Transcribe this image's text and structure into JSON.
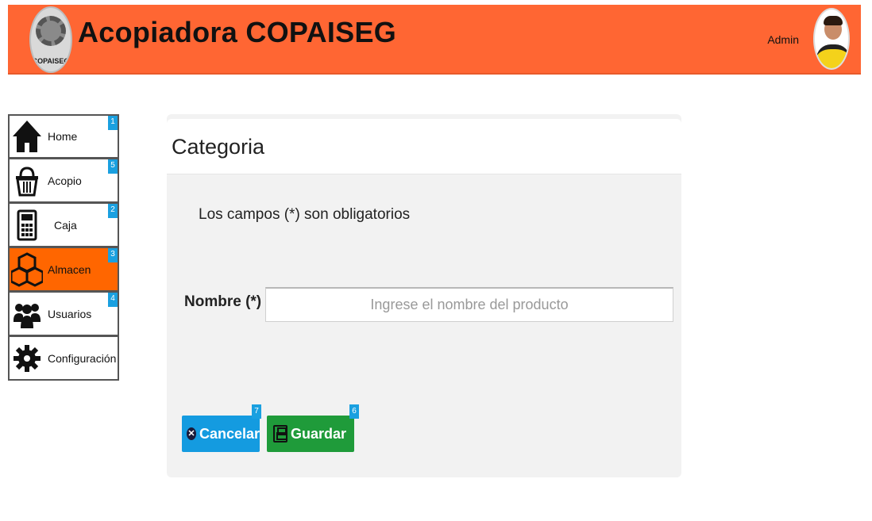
{
  "header": {
    "logo_text": "COPAISEG",
    "title": "Acopiadora COPAISEG",
    "user": "Admin",
    "colors": {
      "bar": "#ff6633"
    }
  },
  "sidebar": {
    "items": [
      {
        "label": "Home",
        "icon": "home-icon",
        "badge": "1",
        "active": false
      },
      {
        "label": "Acopio",
        "icon": "basket-icon",
        "badge": "5",
        "active": false
      },
      {
        "label": "Caja",
        "icon": "calculator-icon",
        "badge": "2",
        "active": false
      },
      {
        "label": "Almacen",
        "icon": "boxes-icon",
        "badge": "3",
        "active": true
      },
      {
        "label": "Usuarios",
        "icon": "users-icon",
        "badge": "4",
        "active": false
      },
      {
        "label": "Configuración",
        "icon": "gear-icon",
        "badge": "",
        "active": false
      }
    ],
    "active_color": "#ff6600",
    "badge_color": "#1aa0e0"
  },
  "form": {
    "title": "Categoria",
    "required_note": "Los campos (*) son obligatorios",
    "name_label": "Nombre (*)",
    "name_value": "",
    "name_placeholder": "Ingrese el nombre del producto",
    "cancel_label": "Cancelar",
    "cancel_badge": "7",
    "save_label": "Guardar",
    "save_badge": "6",
    "colors": {
      "cancel": "#149be0",
      "save": "#1f9b3a"
    }
  }
}
